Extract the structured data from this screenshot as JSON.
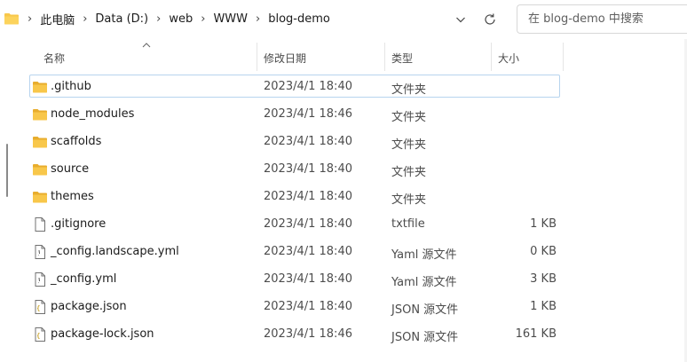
{
  "address_bar": {
    "crumbs": [
      "此电脑",
      "Data (D:)",
      "web",
      "WWW",
      "blog-demo"
    ],
    "dropdown_icon": "chevron-down-icon",
    "refresh_icon": "refresh-icon"
  },
  "search": {
    "placeholder": "在 blog-demo 中搜索"
  },
  "columns": {
    "name": "名称",
    "date": "修改日期",
    "type": "类型",
    "size": "大小"
  },
  "files": [
    {
      "name": ".github",
      "date": "2023/4/1 18:40",
      "type": "文件夹",
      "size": "",
      "icon": "folder-icon"
    },
    {
      "name": "node_modules",
      "date": "2023/4/1 18:46",
      "type": "文件夹",
      "size": "",
      "icon": "folder-icon"
    },
    {
      "name": "scaffolds",
      "date": "2023/4/1 18:40",
      "type": "文件夹",
      "size": "",
      "icon": "folder-icon"
    },
    {
      "name": "source",
      "date": "2023/4/1 18:40",
      "type": "文件夹",
      "size": "",
      "icon": "folder-icon"
    },
    {
      "name": "themes",
      "date": "2023/4/1 18:40",
      "type": "文件夹",
      "size": "",
      "icon": "folder-icon"
    },
    {
      "name": ".gitignore",
      "date": "2023/4/1 18:40",
      "type": "txtfile",
      "size": "1 KB",
      "icon": "file-icon"
    },
    {
      "name": "_config.landscape.yml",
      "date": "2023/4/1 18:40",
      "type": "Yaml 源文件",
      "size": "0 KB",
      "icon": "yaml-file-icon"
    },
    {
      "name": "_config.yml",
      "date": "2023/4/1 18:40",
      "type": "Yaml 源文件",
      "size": "3 KB",
      "icon": "yaml-file-icon"
    },
    {
      "name": "package.json",
      "date": "2023/4/1 18:40",
      "type": "JSON 源文件",
      "size": "1 KB",
      "icon": "json-file-icon"
    },
    {
      "name": "package-lock.json",
      "date": "2023/4/1 18:46",
      "type": "JSON 源文件",
      "size": "161 KB",
      "icon": "json-file-icon"
    }
  ],
  "colors": {
    "folder": "#f8c74a",
    "selection_border": "#b7d4ee"
  }
}
